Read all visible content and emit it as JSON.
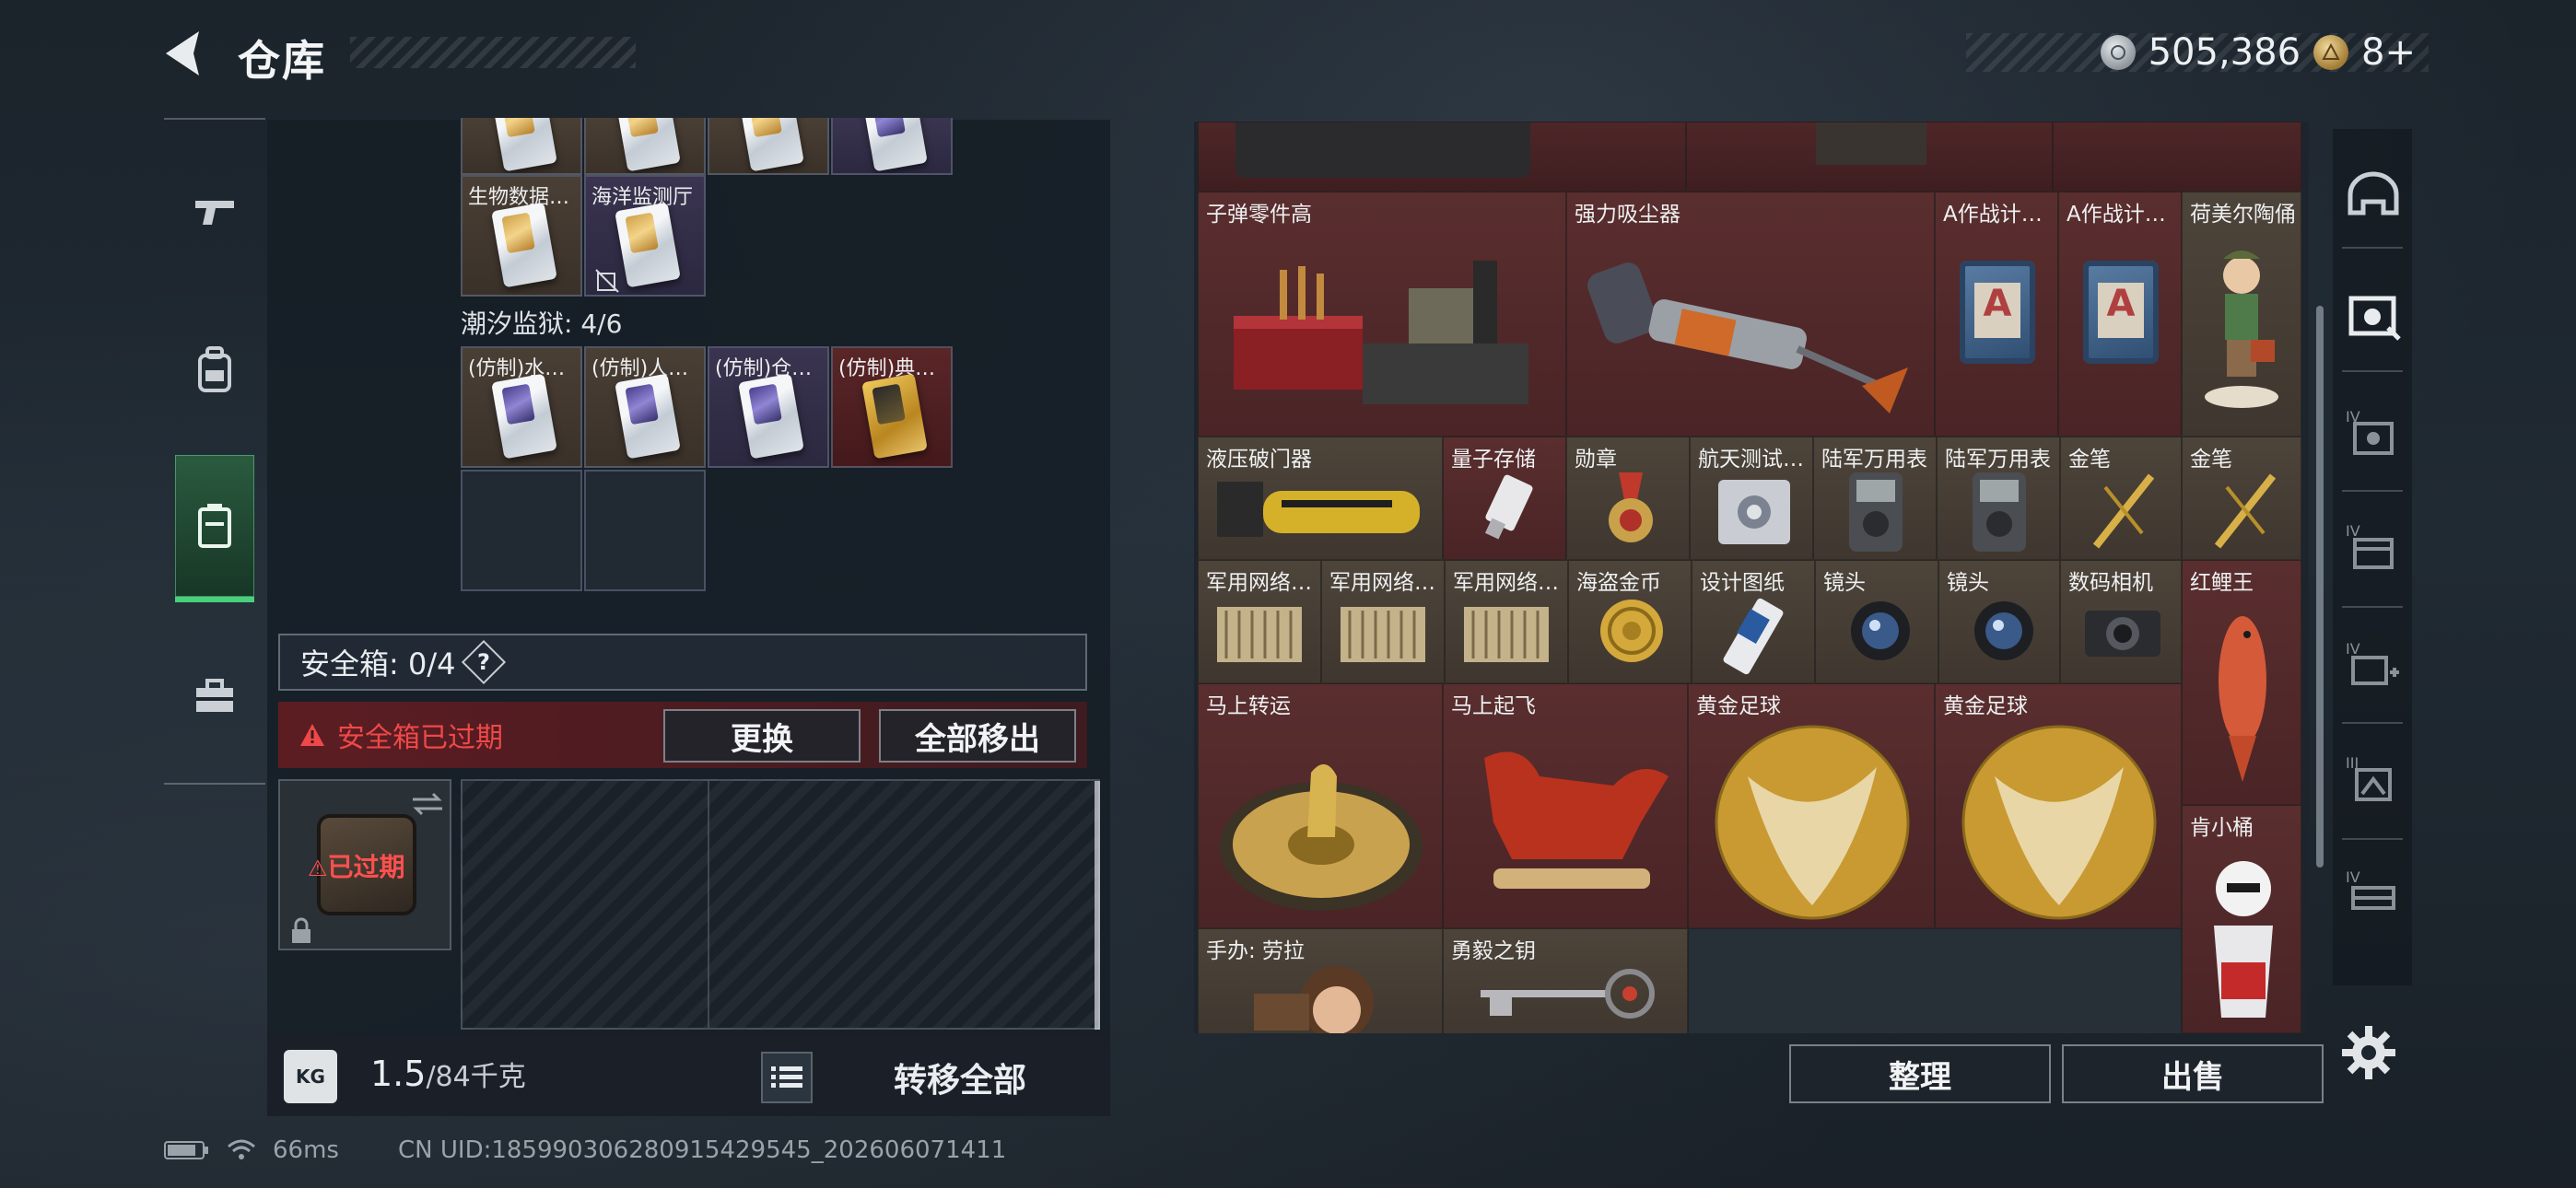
{
  "header": {
    "title": "仓库"
  },
  "currency": {
    "silver": "505,386",
    "gold": "8+"
  },
  "left_rail": [
    "pistol-icon",
    "backpack-icon",
    "storage-icon",
    "toolbox-icon"
  ],
  "storage": {
    "row1_labels": [
      "生物数据…",
      "海洋监测厅"
    ],
    "group": {
      "name": "潮汐监狱: 4/6"
    },
    "group_items": [
      "(仿制)水…",
      "(仿制)人…",
      "(仿制)仓…",
      "(仿制)典…"
    ]
  },
  "safebox": {
    "label": "安全箱: 0/4",
    "help": "?",
    "expired_msg": "安全箱已过期",
    "replace_btn": "更换",
    "move_all_btn": "全部移出",
    "slot_status": "已过期"
  },
  "footer_left": {
    "weight_current": "1.5",
    "weight_max": "/84千克",
    "transfer_btn": "转移全部"
  },
  "inventory": [
    {
      "name": "子弹零件高",
      "color": "red"
    },
    {
      "name": "强力吸尘器",
      "color": "red"
    },
    {
      "name": "A作战计…",
      "color": "red"
    },
    {
      "name": "A作战计…",
      "color": "red"
    },
    {
      "name": "荷美尔陶俑",
      "color": "brown"
    },
    {
      "name": "液压破门器",
      "color": "brown"
    },
    {
      "name": "量子存储",
      "color": "red"
    },
    {
      "name": "勋章",
      "color": "brown"
    },
    {
      "name": "航天测试…",
      "color": "brown"
    },
    {
      "name": "陆军万用表",
      "color": "brown"
    },
    {
      "name": "陆军万用表",
      "color": "brown"
    },
    {
      "name": "金笔",
      "color": "brown"
    },
    {
      "name": "金笔",
      "color": "brown"
    },
    {
      "name": "军用网络…",
      "color": "brown"
    },
    {
      "name": "军用网络…",
      "color": "brown"
    },
    {
      "name": "军用网络…",
      "color": "brown"
    },
    {
      "name": "海盗金币",
      "color": "brown"
    },
    {
      "name": "设计图纸",
      "color": "brown"
    },
    {
      "name": "镜头",
      "color": "brown"
    },
    {
      "name": "镜头",
      "color": "brown"
    },
    {
      "name": "数码相机",
      "color": "brown"
    },
    {
      "name": "红鲤王",
      "color": "red"
    },
    {
      "name": "马上转运",
      "color": "red"
    },
    {
      "name": "马上起飞",
      "color": "red"
    },
    {
      "name": "黄金足球",
      "color": "red"
    },
    {
      "name": "黄金足球",
      "color": "red"
    },
    {
      "name": "肯小桶",
      "color": "red"
    },
    {
      "name": "手办: 劳拉",
      "color": "brown"
    },
    {
      "name": "勇毅之钥",
      "color": "brown"
    }
  ],
  "footer_right": {
    "sort_btn": "整理",
    "sell_btn": "出售"
  },
  "right_rail": [
    "helmet-icon",
    "armor-chest-icon",
    "armor-iv-icon",
    "bag-iv-icon",
    "medkit-iv-icon",
    "armor-iii-icon",
    "rig-iv-icon"
  ],
  "status": {
    "ping": "66ms",
    "uid": "CN UID:185990306280915429545_202606071411"
  }
}
